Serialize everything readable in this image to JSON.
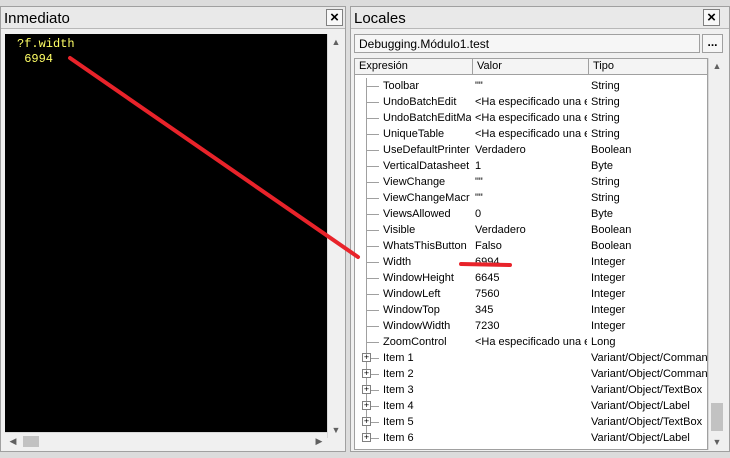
{
  "immediate": {
    "title": "Inmediato",
    "lines": [
      "?f.width",
      " 6994"
    ]
  },
  "locals": {
    "title": "Locales",
    "context": "Debugging.Módulo1.test",
    "context_button": "...",
    "headers": [
      "Expresión",
      "Valor",
      "Tipo"
    ],
    "rows": [
      {
        "expr": "Toolbar",
        "value": "\"\"",
        "type": "String"
      },
      {
        "expr": "UndoBatchEdit",
        "value": "<Ha especificado una e",
        "type": "String"
      },
      {
        "expr": "UndoBatchEditMa",
        "value": "<Ha especificado una e",
        "type": "String"
      },
      {
        "expr": "UniqueTable",
        "value": "<Ha especificado una e",
        "type": "String"
      },
      {
        "expr": "UseDefaultPrinter",
        "value": "Verdadero",
        "type": "Boolean"
      },
      {
        "expr": "VerticalDatasheet",
        "value": "1",
        "type": "Byte"
      },
      {
        "expr": "ViewChange",
        "value": "\"\"",
        "type": "String"
      },
      {
        "expr": "ViewChangeMacr",
        "value": "\"\"",
        "type": "String"
      },
      {
        "expr": "ViewsAllowed",
        "value": "0",
        "type": "Byte"
      },
      {
        "expr": "Visible",
        "value": "Verdadero",
        "type": "Boolean"
      },
      {
        "expr": "WhatsThisButton",
        "value": "Falso",
        "type": "Boolean"
      },
      {
        "expr": "Width",
        "value": "6994",
        "type": "Integer"
      },
      {
        "expr": "WindowHeight",
        "value": "6645",
        "type": "Integer"
      },
      {
        "expr": "WindowLeft",
        "value": "7560",
        "type": "Integer"
      },
      {
        "expr": "WindowTop",
        "value": "345",
        "type": "Integer"
      },
      {
        "expr": "WindowWidth",
        "value": "7230",
        "type": "Integer"
      },
      {
        "expr": "ZoomControl",
        "value": "<Ha especificado una e",
        "type": "Long"
      },
      {
        "expr": "Item 1",
        "value": "",
        "type": "Variant/Object/Command"
      },
      {
        "expr": "Item 2",
        "value": "",
        "type": "Variant/Object/Command"
      },
      {
        "expr": "Item 3",
        "value": "",
        "type": "Variant/Object/TextBox"
      },
      {
        "expr": "Item 4",
        "value": "",
        "type": "Variant/Object/Label"
      },
      {
        "expr": "Item 5",
        "value": "",
        "type": "Variant/Object/TextBox"
      },
      {
        "expr": "Item 6",
        "value": "",
        "type": "Variant/Object/Label"
      }
    ]
  },
  "icons": {
    "close": "close-icon",
    "expand": "plus-icon"
  },
  "colors": {
    "immediate_bg": "#000000",
    "immediate_text": "#ffff66",
    "annotation": "#e8232a"
  }
}
